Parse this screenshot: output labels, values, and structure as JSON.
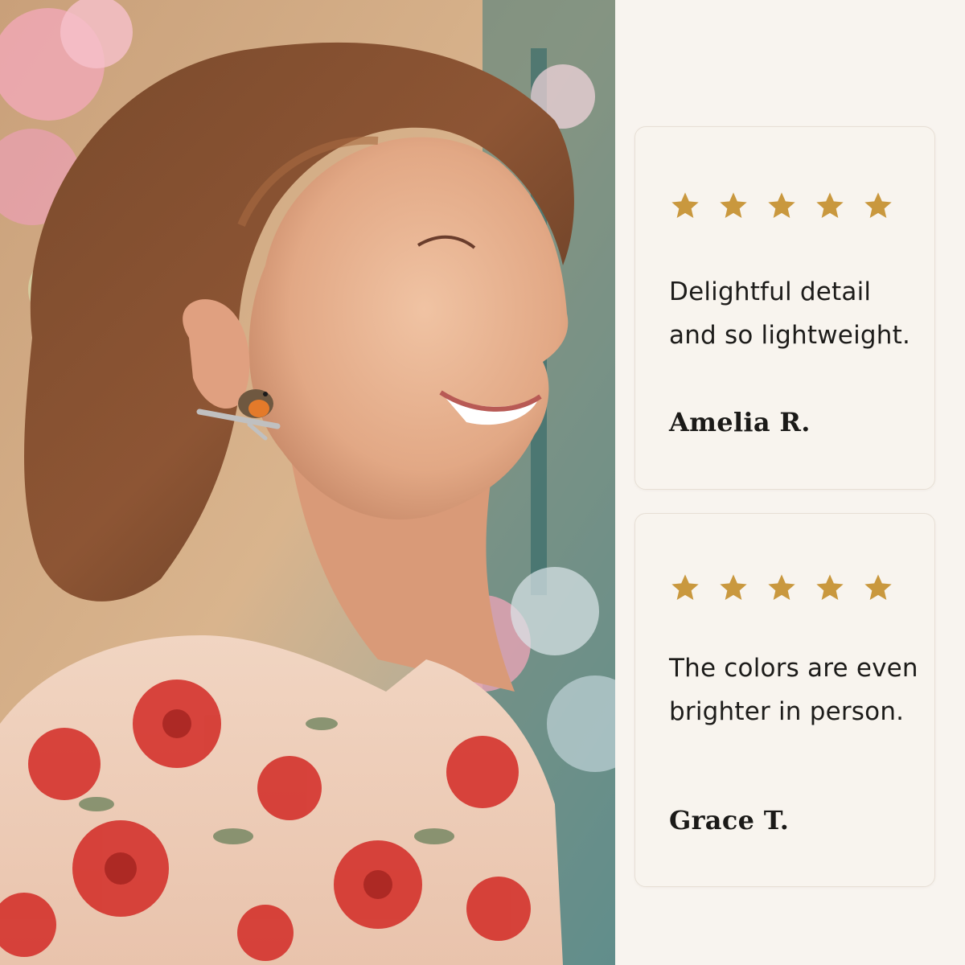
{
  "colors": {
    "panel_background": "#f8f4ef",
    "card_border": "#e7dfd5",
    "star_gold": "#c9983e",
    "text_dark": "#1d1c1a"
  },
  "photo": {
    "icon": "portrait-photo-woman-bird-earring"
  },
  "reviews": [
    {
      "rating": 5,
      "quote": "Delightful detail and so lightweight.",
      "author": "Amelia R."
    },
    {
      "rating": 5,
      "quote": "The colors are even brighter in person.",
      "author": "Grace T."
    }
  ]
}
